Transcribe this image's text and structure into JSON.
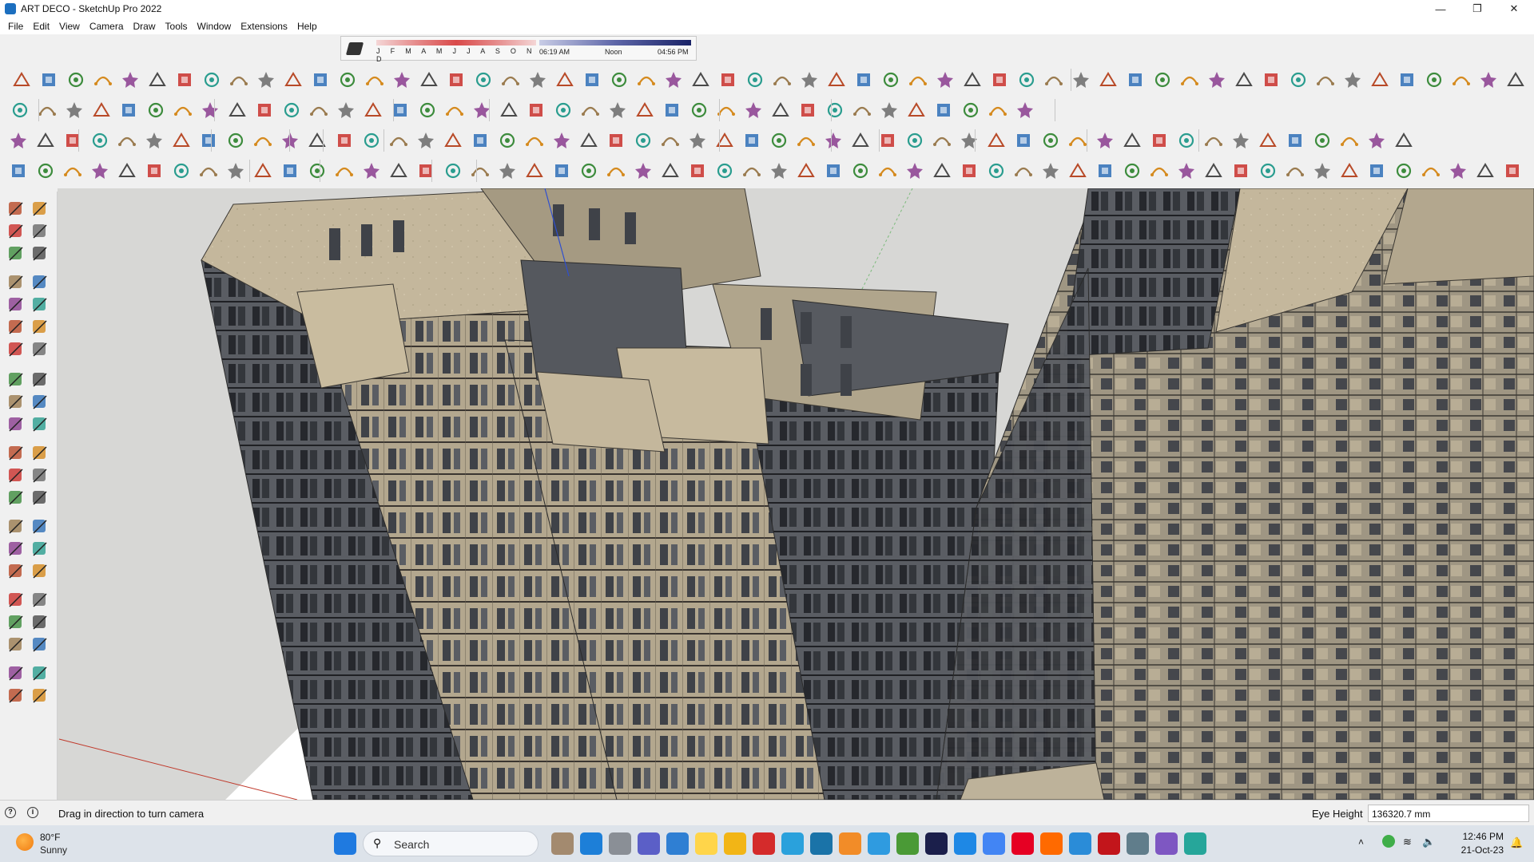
{
  "window": {
    "title": "ART DECO - SketchUp Pro 2022",
    "controls": [
      "minimize-icon",
      "maximize-icon",
      "close-icon"
    ]
  },
  "menubar": {
    "items": [
      "File",
      "Edit",
      "View",
      "Camera",
      "Draw",
      "Tools",
      "Window",
      "Extensions",
      "Help"
    ]
  },
  "shadows": {
    "months": "J F M A M J J A S O N D",
    "time_start": "06:19 AM",
    "time_mid": "Noon",
    "time_end": "04:56 PM"
  },
  "status": {
    "message": "Drag in direction to turn camera",
    "vcb_label": "Eye Height",
    "vcb_value": "136320.7 mm"
  },
  "taskbar": {
    "temperature": "80°F",
    "condition": "Sunny",
    "search_placeholder": "Search",
    "time": "12:46 PM",
    "date": "21-Oct-23",
    "apps": [
      "windows-start-icon",
      "file-explorer-icon",
      "opera-icon",
      "telegram-icon",
      "chrome-icon",
      "pinterest-icon",
      "sketchup-icon",
      "acrobat-icon",
      "photoshop-icon"
    ]
  },
  "colors": {
    "building_light": "#b3a78e",
    "building_dark": "#4c5058",
    "sky": "#d6d6d4",
    "ground": "#ffffff",
    "accent_red": "#d8261c"
  }
}
